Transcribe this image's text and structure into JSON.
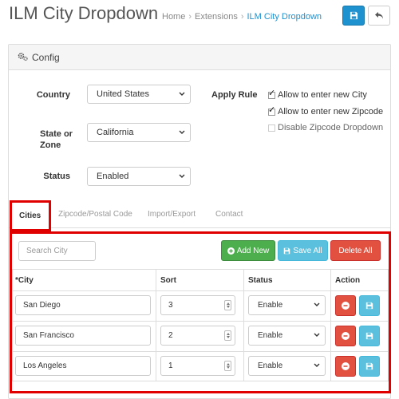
{
  "header": {
    "title": "ILM City Dropdown",
    "breadcrumb": [
      "Home",
      "Extensions",
      "ILM City Dropdown"
    ]
  },
  "panel": {
    "title": "Config"
  },
  "form": {
    "country_label": "Country",
    "country_value": "United States",
    "state_label_line1": "State or",
    "state_label_line2": "Zone",
    "state_value": "California",
    "status_label": "Status",
    "status_value": "Enabled",
    "apply_rule_label": "Apply Rule",
    "rules": [
      {
        "label": "Allow to enter new City",
        "checked": true
      },
      {
        "label": "Allow to enter new Zipcode",
        "checked": true
      },
      {
        "label": "Disable Zipcode Dropdown",
        "checked": false
      }
    ]
  },
  "tabs": [
    "Cities",
    "Zipcode/Postal Code",
    "Import/Export",
    "Contact"
  ],
  "toolbar": {
    "search_placeholder": "Search City",
    "add_new_label": "Add New",
    "save_all_label": "Save All",
    "delete_all_label": "Delete All"
  },
  "table": {
    "columns": [
      "*City",
      "Sort",
      "Status",
      "Action"
    ],
    "rows": [
      {
        "city": "San Diego",
        "sort": "3",
        "status": "Enable"
      },
      {
        "city": "San Francisco",
        "sort": "2",
        "status": "Enable"
      },
      {
        "city": "Los Angeles",
        "sort": "1",
        "status": "Enable"
      }
    ]
  },
  "colors": {
    "primary": "#1e91cf",
    "success": "#4cae4c",
    "info": "#5bc0de",
    "danger": "#e25140",
    "highlight": "#e00000"
  },
  "icons": {
    "save_top": "floppy-icon",
    "back_top": "reply-icon",
    "panel": "gear-icon",
    "add": "plus-circle-icon",
    "save_all": "floppy-icon",
    "row_delete": "minus-circle-icon",
    "row_save": "floppy-icon"
  }
}
